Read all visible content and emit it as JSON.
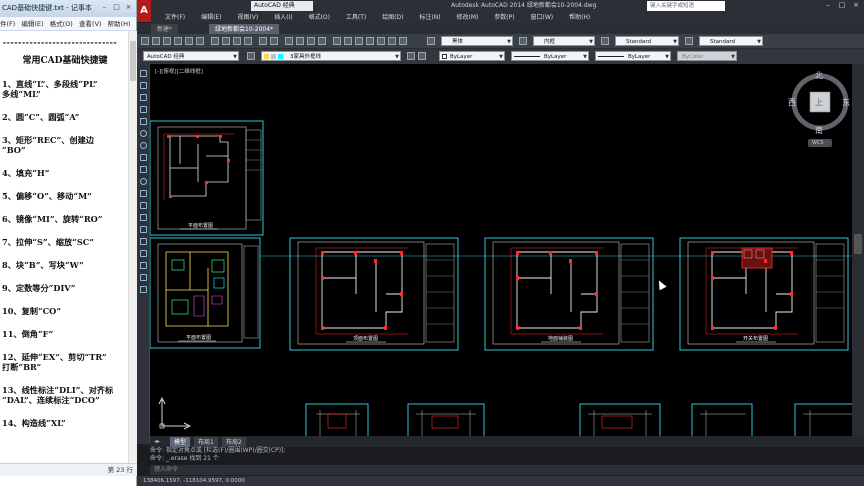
{
  "notepad": {
    "title": "CAD基础快捷键.txt - 记事本",
    "menu": [
      "件(F)",
      "编辑(E)",
      "格式(O)",
      "查看(V)",
      "帮助(H)"
    ],
    "dashes": "------------------------------",
    "heading": "常用CAD基础快捷键",
    "lines": [
      "1、直线“L”、多段线“PL”",
      "多线“ML”",
      "2、圆“C”、圆弧“A”",
      "3、矩形“REC”、创建边",
      "“BO”",
      "4、填充“H”",
      "5、偏移“O”、移动“M”",
      "6、镜像“MI”、旋转“RO”",
      "7、拉伸“S”、缩放“SC”",
      "8、块“B”、写块“W”",
      "9、定数等分“DIV”",
      "10、复制“CO”",
      "11、倒角“F”",
      "12、延伸“EX”、剪切“TR”",
      "打断“BR”",
      "13、线性标注“DLI”、对齐标",
      "“DAL”、连续标注“DCO”",
      "14、构造线“XL”"
    ],
    "status": "第 23 行"
  },
  "acad": {
    "workspace": "AutoCAD 经典",
    "app_title": "Autodesk AutoCAD 2014    绿地新都会10-2004.dwg",
    "search_placeholder": "键入关键字或短语",
    "menu": [
      "文件(F)",
      "编辑(E)",
      "视图(V)",
      "插入(I)",
      "格式(O)",
      "工具(T)",
      "绘图(D)",
      "标注(N)",
      "修改(M)",
      "参数(P)",
      "窗口(W)",
      "帮助(H)"
    ],
    "doc_tabs": [
      "新建*",
      "绿地新都会10-2004*"
    ],
    "toolbar_workspace": "AutoCAD 经典",
    "font_combo": "黑体",
    "dim_combo": "内框",
    "style1": "Standard",
    "style2": "Standard",
    "layer_combo": "3家具外框线",
    "color_combo": "ByLayer",
    "linetype_combo": "ByLayer",
    "lineweight_combo": "ByLayer",
    "plot_combo": "ByColor",
    "viewport_label": "[-][俯视][二维线框]",
    "compass": {
      "north": "北",
      "south": "南",
      "east": "东",
      "west": "西",
      "top": "上",
      "wcs": "WCS"
    },
    "sheet_titles": [
      "平面布置图",
      "平面布置图",
      "顶面布置图",
      "地面铺装图",
      "开关布置图"
    ],
    "layout_tabs": [
      "模型",
      "布局1",
      "布局2"
    ],
    "cmd_lines": [
      "命令: 指定对角点或 [栏选(F)/圈围(WP)/圈交(CP)]:",
      "命令: _.erase 找到 21 个"
    ],
    "cmd_placeholder": "键入命令",
    "coords": "138406.1597, -118104.9597, 0.0000",
    "accent": "#2ec4d6"
  }
}
